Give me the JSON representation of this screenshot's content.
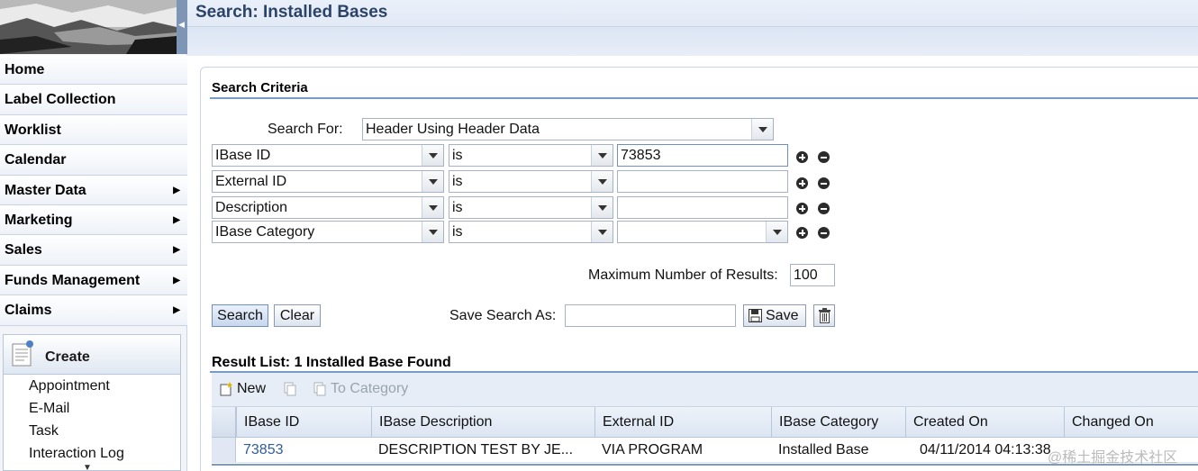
{
  "page": {
    "title": "Search: Installed Bases"
  },
  "nav": {
    "items": [
      {
        "label": "Home",
        "has_arrow": false
      },
      {
        "label": "Label Collection",
        "has_arrow": false
      },
      {
        "label": "Worklist",
        "has_arrow": false
      },
      {
        "label": "Calendar",
        "has_arrow": false
      },
      {
        "label": "Master Data",
        "has_arrow": true
      },
      {
        "label": "Marketing",
        "has_arrow": true
      },
      {
        "label": "Sales",
        "has_arrow": true
      },
      {
        "label": "Funds Management",
        "has_arrow": true
      },
      {
        "label": "Claims",
        "has_arrow": true
      }
    ],
    "create": {
      "title": "Create",
      "links": [
        "Appointment",
        "E-Mail",
        "Task",
        "Interaction Log"
      ]
    }
  },
  "criteria": {
    "title": "Search Criteria",
    "search_for_label": "Search For:",
    "search_for_value": "Header Using Header Data",
    "rows": [
      {
        "field": "IBase ID",
        "operator": "is",
        "value": "73853"
      },
      {
        "field": "External ID",
        "operator": "is",
        "value": ""
      },
      {
        "field": "Description",
        "operator": "is",
        "value": ""
      },
      {
        "field": "IBase Category",
        "operator": "is",
        "value": ""
      }
    ],
    "max_results_label": "Maximum Number of Results:",
    "max_results_value": "100",
    "search_button": "Search",
    "clear_button": "Clear",
    "save_search_label": "Save Search As:",
    "save_search_value": "",
    "save_button": "Save"
  },
  "results": {
    "title": "Result List: 1 Installed Base Found",
    "toolbar": {
      "new": "New",
      "to_category": "To Category"
    },
    "columns": [
      "IBase ID",
      "IBase Description",
      "External ID",
      "IBase Category",
      "Created On",
      "Changed On"
    ],
    "rows": [
      {
        "ibase_id": "73853",
        "description": "DESCRIPTION TEST BY JE...",
        "external_id": "VIA PROGRAM",
        "category": "Installed Base",
        "created_on": "04/11/2014 04:13:38",
        "changed_on": ""
      }
    ]
  },
  "watermark": "@稀土掘金技术社区",
  "colors": {
    "accent": "#2c4368",
    "link": "#2f5c9c",
    "rule": "#7a9cc4"
  }
}
